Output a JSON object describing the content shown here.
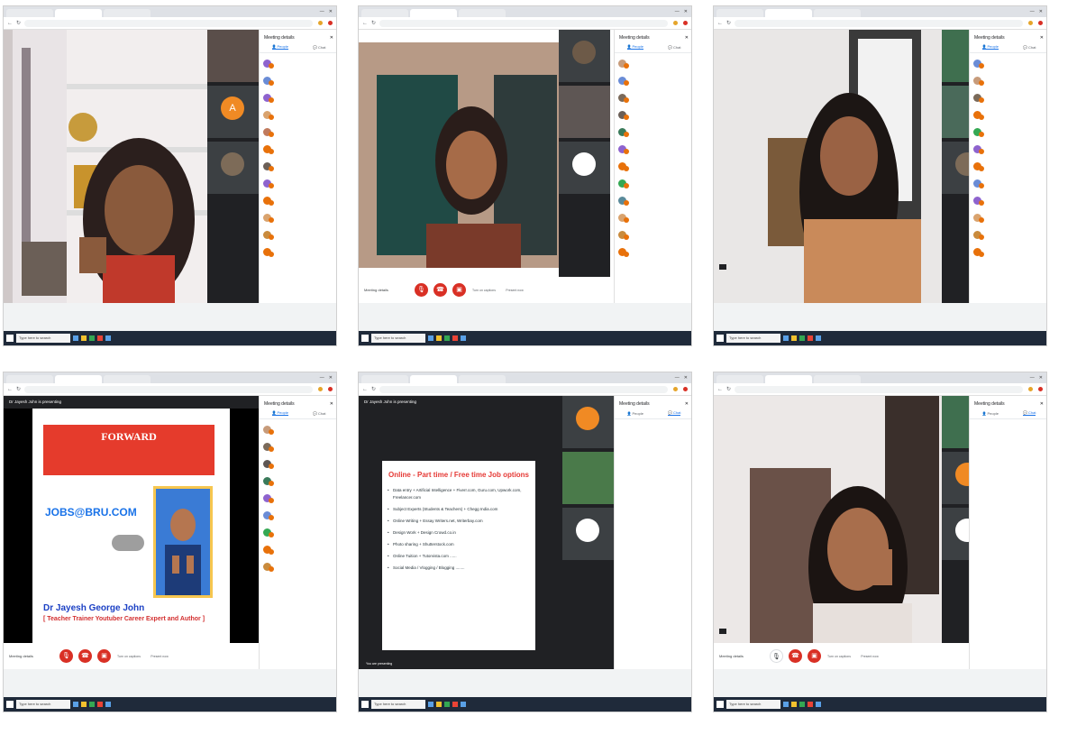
{
  "window": {
    "tabs": [
      "",
      "",
      "",
      ""
    ],
    "url": "",
    "controls": [
      "—",
      "☐",
      "✕"
    ]
  },
  "meet": {
    "side_title": "Meeting details",
    "people_tab": "People",
    "chat_tab": "Chat",
    "meeting_details": "Meeting details",
    "turn_on_captions": "Turn on captions",
    "present_now": "Present now",
    "presenting": "Dr Jayesh John is presenting",
    "you_presenting": "You are presenting"
  },
  "slides": {
    "forward_title": "FORWARD",
    "logo": "JOBS@BRU.COM",
    "dr_name": "Dr Jayesh George John",
    "dr_role": "[ Teacher Trainer Youtuber Career Expert and Author ]",
    "online_title": "Online - Part time / Free time Job options",
    "bullets": [
      "Data entry + Artificial Intelligence + Fiverr.com, Guru.com, Upwork.com, Freelancer.com",
      "Subject Experts (Students & Teachers) + Chegg India.com",
      "Online Writing + Essay Writers.net, Writerbay.com",
      "Design Work + Design Crowd.co.in",
      "Photo sharing + Shutterstock.com",
      "Online Tuition + Tutorvista.com ......",
      "Social Media / Vlogging / Blogging ........"
    ]
  },
  "taskbar": {
    "search": "Type here to search"
  }
}
